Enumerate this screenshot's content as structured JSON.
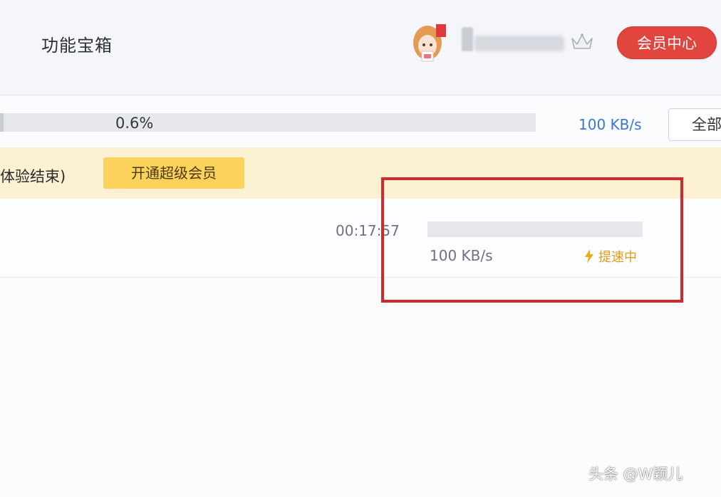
{
  "header": {
    "title": "功能宝箱",
    "vip_center_label": "会员中心",
    "avatar_icon": "avatar-icon",
    "crown_icon": "crown-icon"
  },
  "download_summary": {
    "progress_label": "0.6%",
    "progress_fraction": 0.006,
    "speed": "100 KB/s",
    "all_button_label": "全部"
  },
  "banner": {
    "text": "体验结束)",
    "upgrade_button_label": "开通超级会员"
  },
  "task": {
    "remaining_time": "00:17:57",
    "speed": "100 KB/s",
    "boost_label": "提速中",
    "boost_icon": "lightning-icon"
  },
  "watermark": "头条 @W颖儿",
  "colors": {
    "vip_button": "#e1453e",
    "upgrade_button": "#fbd25c",
    "banner_bg": "#fdf1d3",
    "speed_text": "#3a79c9",
    "boost_text": "#e29a17",
    "highlight_border": "#d02a2a"
  }
}
